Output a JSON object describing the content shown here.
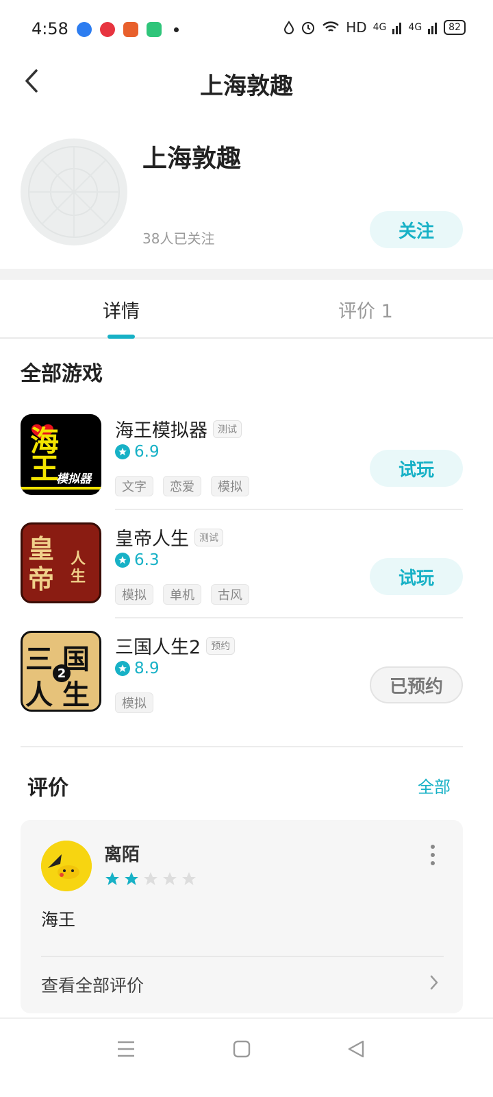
{
  "status_bar": {
    "time": "4:58",
    "network": "HD",
    "signal_1": "4G",
    "signal_2": "4G",
    "battery": "82"
  },
  "header": {
    "title": "上海敦趣"
  },
  "profile": {
    "name": "上海敦趣",
    "followers": "38人已关注",
    "follow_label": "关注"
  },
  "tabs": [
    {
      "label": "详情",
      "active": true
    },
    {
      "label": "评价 1",
      "active": false
    }
  ],
  "games_section": {
    "title": "全部游戏",
    "games": [
      {
        "name": "海王模拟器",
        "badge": "测试",
        "rating": "6.9",
        "tags": [
          "文字",
          "恋爱",
          "模拟"
        ],
        "action": "试玩",
        "icon_text_main": "海王",
        "icon_text_sub": "模拟器"
      },
      {
        "name": "皇帝人生",
        "badge": "测试",
        "rating": "6.3",
        "tags": [
          "模拟",
          "单机",
          "古风"
        ],
        "action": "试玩",
        "icon_text_main": "皇帝",
        "icon_text_sub": "人生"
      },
      {
        "name": "三国人生2",
        "badge": "预约",
        "rating": "8.9",
        "tags": [
          "模拟"
        ],
        "action": "已预约",
        "icon_text_main": "三国",
        "icon_text_sub": "人生"
      }
    ]
  },
  "reviews": {
    "title": "评价",
    "all_label": "全部",
    "card": {
      "user": "离陌",
      "stars": 2,
      "stars_max": 5,
      "text": "海王",
      "view_all": "查看全部评价"
    }
  },
  "colors": {
    "accent": "#17b1c6",
    "accent_bg": "#e9f8f9"
  }
}
